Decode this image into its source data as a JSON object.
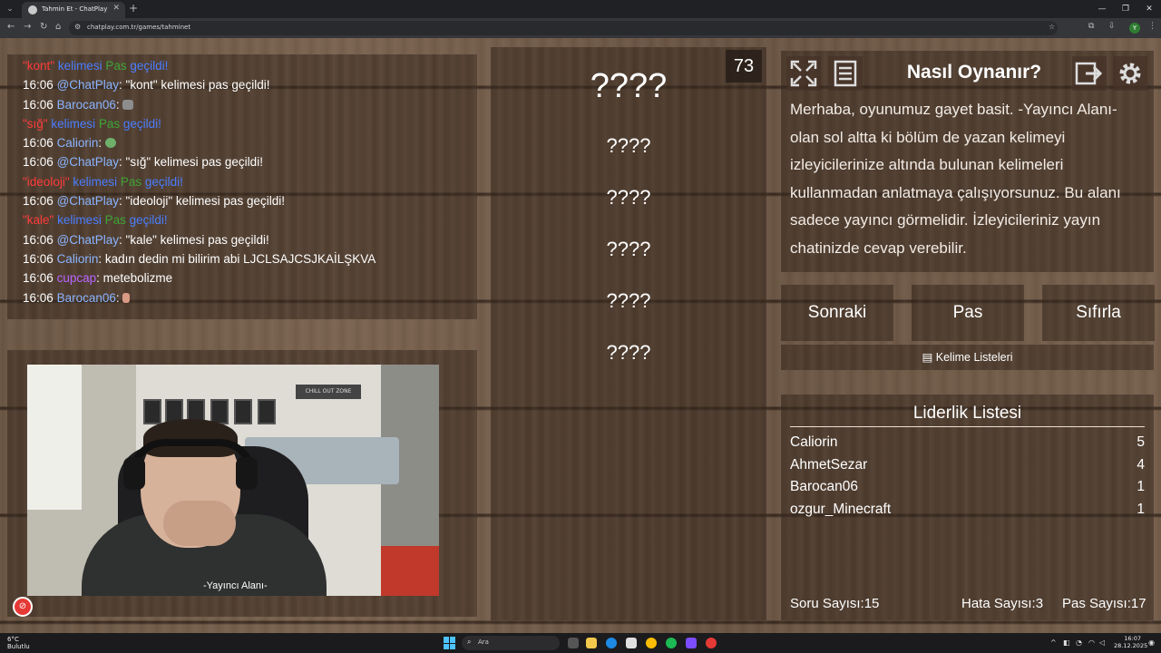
{
  "browser": {
    "tab_title": "Tahmin Et - ChatPlay",
    "url": "chatplay.com.tr/games/tahminet",
    "profile_initial": "Y"
  },
  "chat": {
    "lines": [
      {
        "word": "\"kont\"",
        "mid": " kelimesi ",
        "pas": "Pas",
        "end": " geçildi!"
      },
      {
        "time": "16:06",
        "user": "@ChatPlay",
        "text": ": \"kont\" kelimesi pas geçildi!"
      },
      {
        "time": "16:06",
        "user": "Barocan06",
        "text": ":"
      },
      {
        "word": "\"sığ\"",
        "mid": " kelimesi ",
        "pas": "Pas",
        "end": " geçildi!"
      },
      {
        "time": "16:06",
        "user": "Caliorin",
        "text": ":"
      },
      {
        "time": "16:06",
        "user": "@ChatPlay",
        "text": ": \"sığ\" kelimesi pas geçildi!"
      },
      {
        "word": "\"ideoloji\"",
        "mid": " kelimesi ",
        "pas": "Pas",
        "end": " geçildi!"
      },
      {
        "time": "16:06",
        "user": "@ChatPlay",
        "text": ": \"ideoloji\" kelimesi pas geçildi!"
      },
      {
        "word": "\"kale\"",
        "mid": " kelimesi ",
        "pas": "Pas",
        "end": " geçildi!"
      },
      {
        "time": "16:06",
        "user": "@ChatPlay",
        "text": ": \"kale\" kelimesi pas geçildi!"
      },
      {
        "time": "16:06",
        "user": "Caliorin",
        "text": ": kadın dedin mi bilirim abi LJCLSAJCSJKAİLŞKVA"
      },
      {
        "time": "16:06",
        "user": "cupcap",
        "text": ": metebolizme"
      },
      {
        "time": "16:06",
        "user": "Barocan06",
        "text": ":"
      }
    ]
  },
  "webcam": {
    "caption": "-Yayıncı Alanı-",
    "sign_text": "CHILL OUT ZONE"
  },
  "words": {
    "timer": "73",
    "main": "????",
    "items": [
      "????",
      "????",
      "????",
      "????",
      "????"
    ]
  },
  "howto": {
    "title": "Nasıl Oynanır?",
    "text": "Merhaba, oyunumuz gayet basit. -Yayıncı Alanı- olan sol altta ki bölüm de yazan kelimeyi izleyicilerinize altında bulunan kelimeleri kullanmadan anlatmaya çalışıyorsunuz. Bu alanı sadece yayıncı görmelidir. İzleyicileriniz yayın chatinizde cevap verebilir."
  },
  "actions": {
    "next": "Sonraki",
    "pass": "Pas",
    "reset": "Sıfırla",
    "word_lists": "Kelime Listeleri"
  },
  "leaderboard": {
    "title": "Liderlik Listesi",
    "rows": [
      {
        "name": "Caliorin",
        "score": "5"
      },
      {
        "name": "AhmetSezar",
        "score": "4"
      },
      {
        "name": "Barocan06",
        "score": "1"
      },
      {
        "name": "ozgur_Minecraft",
        "score": "1"
      }
    ]
  },
  "stats": {
    "questions_label": "Soru Sayısı:",
    "questions": "15",
    "errors_label": "Hata Sayısı:",
    "errors": "3",
    "passes_label": "Pas Sayısı:",
    "passes": "17"
  },
  "taskbar": {
    "temp": "6°C",
    "weather": "Bulutlu",
    "search": "Ara",
    "time": "16:07",
    "date": "28.12.2025"
  },
  "colors": {
    "user_name": "#8ab4ff",
    "pass_word": "#ff3b3b",
    "kelimesi": "#4a7dff",
    "pas": "#3ea536",
    "cupcap": "#b864ff"
  }
}
